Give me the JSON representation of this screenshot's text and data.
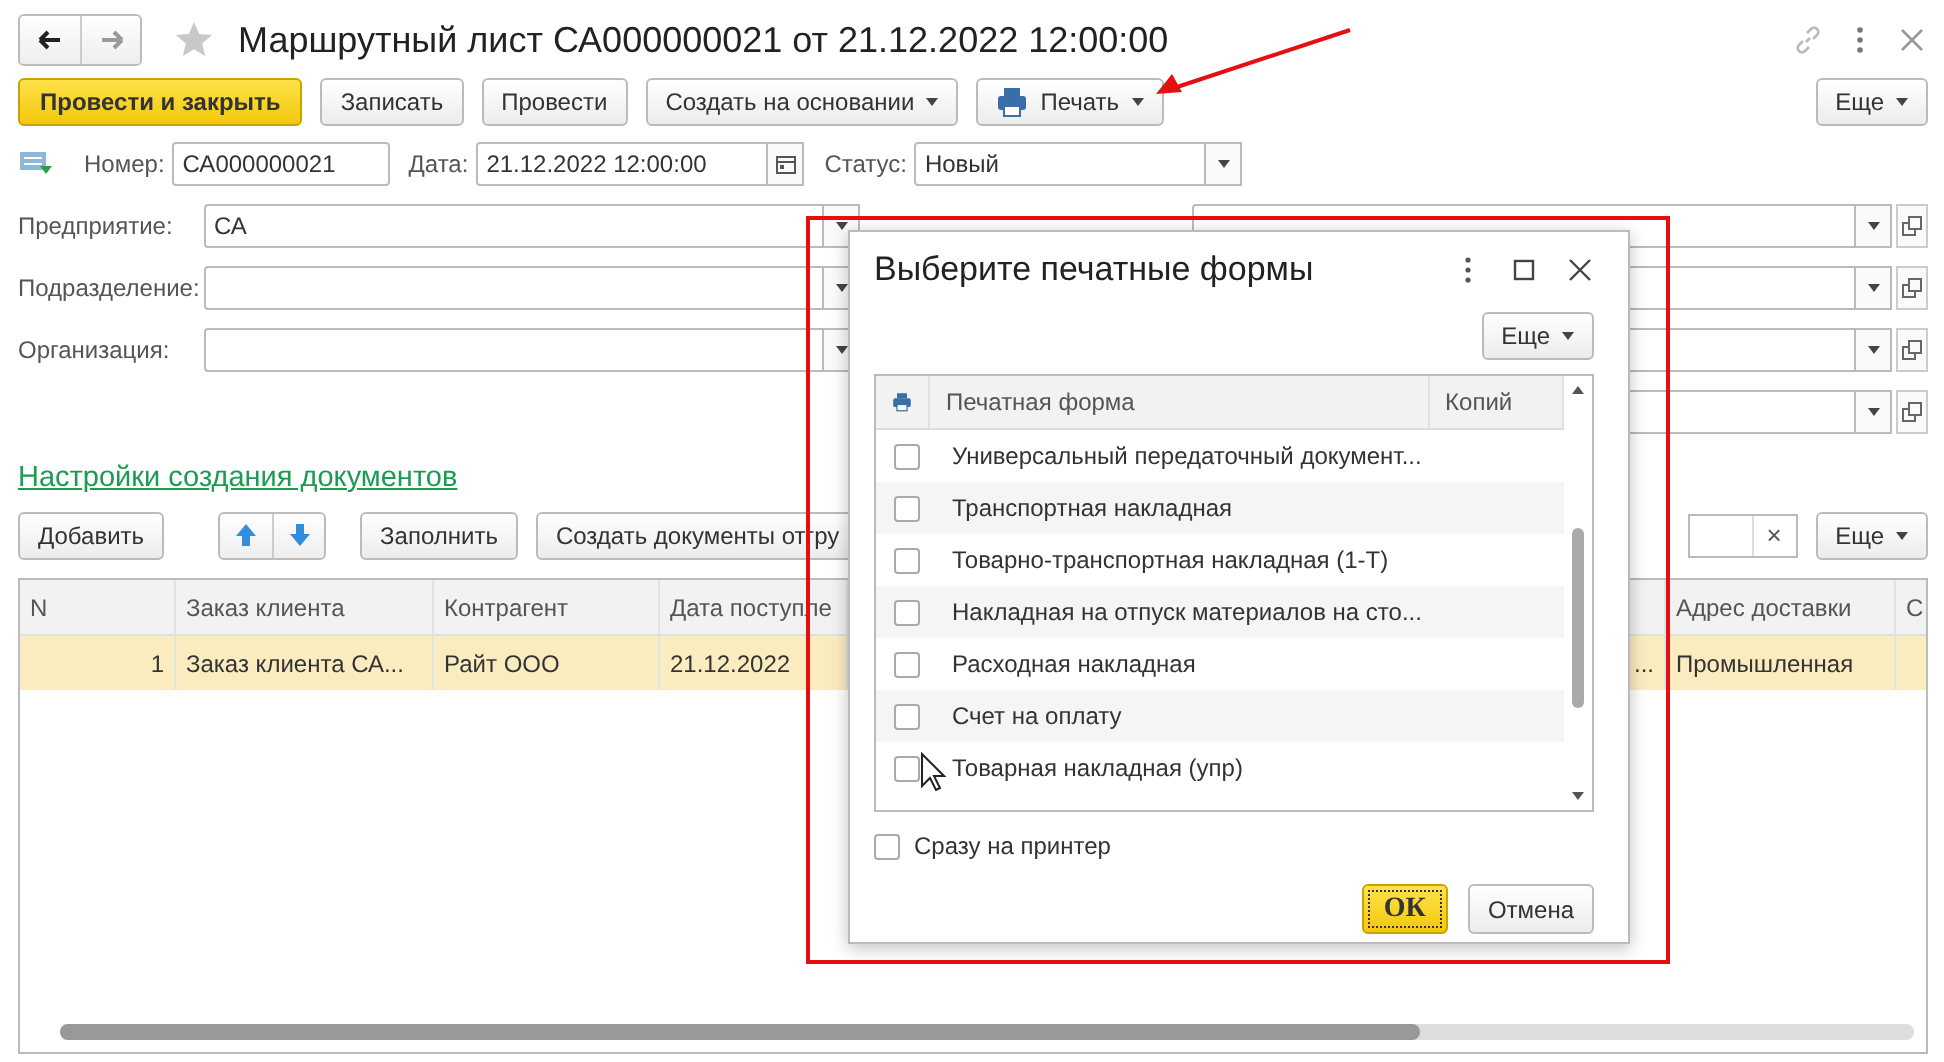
{
  "window": {
    "title": "Маршрутный лист СА000000021 от 21.12.2022 12:00:00"
  },
  "toolbar": {
    "buttons": [
      {
        "label": "Провести и закрыть",
        "kind": "primary"
      },
      {
        "label": "Записать",
        "kind": "plain"
      },
      {
        "label": "Провести",
        "kind": "plain"
      },
      {
        "label": "Создать на основании",
        "kind": "menu"
      },
      {
        "label": "Печать",
        "kind": "print"
      }
    ],
    "more": "Еще"
  },
  "header_fields": [
    {
      "label": "Номер:",
      "value": "СА000000021",
      "kind": "text"
    },
    {
      "label": "Дата:",
      "value": "21.12.2022 12:00:00",
      "kind": "date"
    },
    {
      "label": "Статус:",
      "value": "Новый",
      "kind": "select"
    }
  ],
  "fields": [
    {
      "label": "Предприятие:",
      "value": "СА"
    },
    {
      "label": "Подразделение:"
    },
    {
      "label": "Организация:"
    }
  ],
  "settings_link": "Настройки создания документов",
  "table_toolbar": {
    "items": [
      {
        "kind": "button",
        "label": "Добавить"
      },
      {
        "kind": "updown"
      },
      {
        "kind": "button",
        "label": "Заполнить"
      },
      {
        "kind": "button",
        "label": "Создать документы отгру"
      }
    ],
    "search_clear": "×",
    "more": "Еще"
  },
  "table": {
    "columns": [
      {
        "kind": "text",
        "label": "N"
      },
      {
        "kind": "text",
        "label": "Заказ клиента"
      },
      {
        "kind": "text",
        "label": "Контрагент"
      },
      {
        "kind": "text",
        "label": "Дата поступле"
      },
      {
        "kind": "covered"
      },
      {
        "kind": "text",
        "label": "Адрес доставки"
      },
      {
        "kind": "text",
        "label": "С"
      }
    ],
    "rows": [
      {
        "selected": true,
        "cells": [
          "1",
          "Заказ клиента СА...",
          "Райт ООО",
          "21.12.2022",
          "...",
          "Промышленная"
        ]
      }
    ]
  },
  "dialog": {
    "title": "Выберите печатные формы",
    "more": "Еще",
    "columns": [
      "Печатная форма",
      "Копий"
    ],
    "forms": [
      {
        "label": "Универсальный передаточный документ...",
        "checked": false
      },
      {
        "label": "Транспортная накладная",
        "checked": false
      },
      {
        "label": "Товарно-транспортная накладная (1-Т)",
        "checked": false
      },
      {
        "label": "Накладная на отпуск материалов на сто...",
        "checked": false
      },
      {
        "label": "Расходная накладная",
        "checked": false
      },
      {
        "label": "Счет на оплату",
        "checked": false
      },
      {
        "label": "Товарная накладная (упр)",
        "checked": false
      }
    ],
    "print_directly": {
      "label": "Сразу на принтер",
      "checked": false
    },
    "buttons": [
      {
        "label": "ОК",
        "kind": "default"
      },
      {
        "label": "Отмена",
        "kind": "plain"
      }
    ]
  }
}
